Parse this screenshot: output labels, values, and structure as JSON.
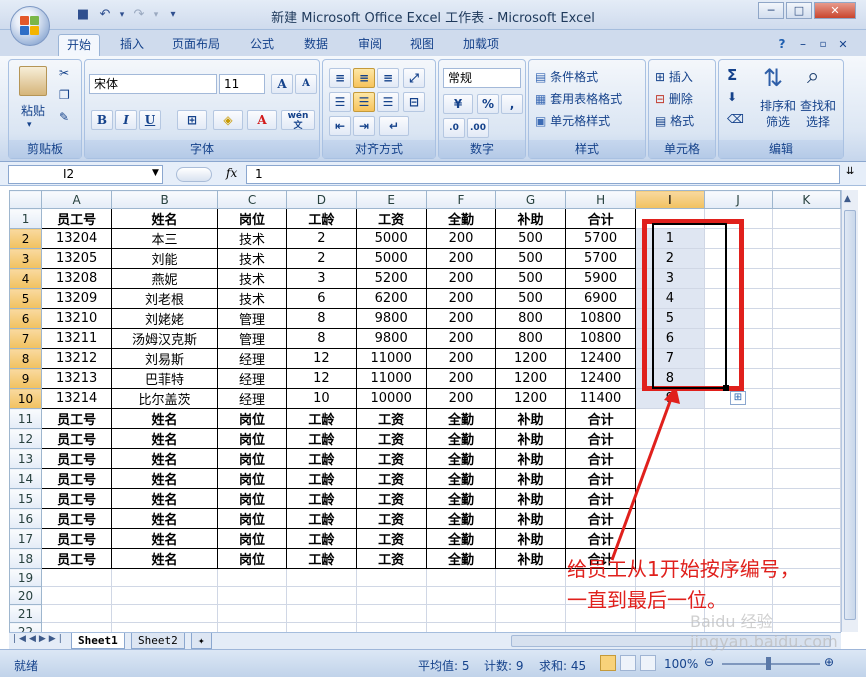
{
  "app": {
    "title": "新建 Microsoft Office Excel 工作表 - Microsoft Excel",
    "minimize": "─",
    "maximize": "□",
    "close": "✕"
  },
  "qat": {
    "save_icon": "save-icon",
    "undo_icon": "undo-icon",
    "redo_icon": "redo-icon",
    "customize": "▾"
  },
  "tabs": [
    "开始",
    "插入",
    "页面布局",
    "公式",
    "数据",
    "审阅",
    "视图",
    "加载项"
  ],
  "ribbon": {
    "clipboard": {
      "label": "剪贴板",
      "paste": "粘贴"
    },
    "font": {
      "label": "字体",
      "family": "宋体",
      "size": "11",
      "grow": "A",
      "shrink": "A",
      "bold": "B",
      "italic": "I",
      "underline": "U",
      "wen": "wén 文"
    },
    "alignment": {
      "label": "对齐方式"
    },
    "number": {
      "label": "数字",
      "format": "常规",
      "percent": "%",
      "comma": ","
    },
    "styles": {
      "label": "样式",
      "conditional": "条件格式",
      "table": "套用表格格式",
      "cell": "单元格样式"
    },
    "cells": {
      "label": "单元格",
      "insert": "插入",
      "delete": "删除",
      "format": "格式"
    },
    "editing": {
      "label": "编辑",
      "sort": "排序和筛选",
      "find": "查找和选择",
      "sigma": "Σ"
    }
  },
  "formula_bar": {
    "name_box": "I2",
    "fx": "fx",
    "value": "1"
  },
  "columns": [
    "A",
    "B",
    "C",
    "D",
    "E",
    "F",
    "G",
    "H",
    "I",
    "J",
    "K"
  ],
  "row_numbers": [
    "1",
    "2",
    "3",
    "4",
    "5",
    "6",
    "7",
    "8",
    "9",
    "10",
    "11",
    "12",
    "13",
    "14",
    "15",
    "16",
    "17",
    "18",
    "19",
    "20",
    "21",
    "22",
    "23"
  ],
  "header_row": [
    "员工号",
    "姓名",
    "岗位",
    "工龄",
    "工资",
    "全勤",
    "补助",
    "合计"
  ],
  "data_rows": [
    [
      "13204",
      "本三",
      "技术",
      "2",
      "5000",
      "200",
      "500",
      "5700",
      "1"
    ],
    [
      "13205",
      "刘能",
      "技术",
      "2",
      "5000",
      "200",
      "500",
      "5700",
      "2"
    ],
    [
      "13208",
      "燕妮",
      "技术",
      "3",
      "5200",
      "200",
      "500",
      "5900",
      "3"
    ],
    [
      "13209",
      "刘老根",
      "技术",
      "6",
      "6200",
      "200",
      "500",
      "6900",
      "4"
    ],
    [
      "13210",
      "刘姥姥",
      "管理",
      "8",
      "9800",
      "200",
      "800",
      "10800",
      "5"
    ],
    [
      "13211",
      "汤姆汉克斯",
      "管理",
      "8",
      "9800",
      "200",
      "800",
      "10800",
      "6"
    ],
    [
      "13212",
      "刘易斯",
      "经理",
      "12",
      "11000",
      "200",
      "1200",
      "12400",
      "7"
    ],
    [
      "13213",
      "巴菲特",
      "经理",
      "12",
      "11000",
      "200",
      "1200",
      "12400",
      "8"
    ],
    [
      "13214",
      "比尔盖茨",
      "经理",
      "10",
      "10000",
      "200",
      "1200",
      "11400",
      "9"
    ]
  ],
  "sheets": [
    "Sheet1",
    "Sheet2"
  ],
  "status": {
    "ready": "就绪",
    "avg": "平均值: 5",
    "count": "计数: 9",
    "sum": "求和: 45",
    "zoom": "100%"
  },
  "annotation": {
    "line1": "给员工从1开始按序编号，",
    "line2": "一直到最后一位。",
    "color": "#e0201c"
  },
  "watermark": "Baidu 经验 jingyan.baidu.com"
}
